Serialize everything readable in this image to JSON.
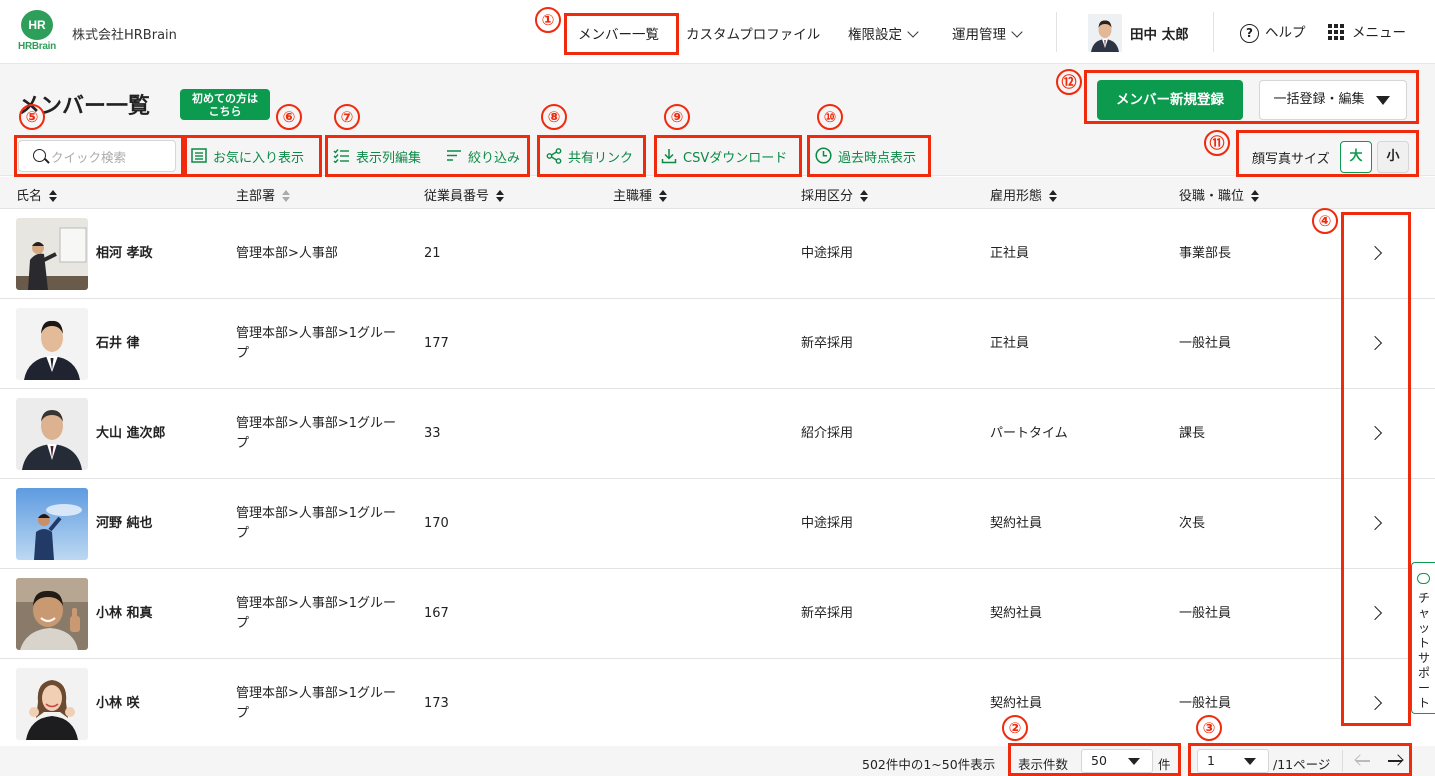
{
  "header": {
    "company": "株式会社HRBrain",
    "logo_mark": "HR",
    "logo_text": "HRBrain",
    "nav": [
      {
        "label": "メンバー一覧"
      },
      {
        "label": "カスタムプロファイル"
      },
      {
        "label": "権限設定"
      },
      {
        "label": "運用管理"
      }
    ],
    "user_name": "田中 太郎",
    "help_label": "ヘルプ",
    "menu_label": "メニュー"
  },
  "page": {
    "title": "メンバー一覧",
    "first_time_badge_line1": "初めての方は",
    "first_time_badge_line2": "こちら",
    "register_button": "メンバー新規登録",
    "bulk_button": "一括登録・編集"
  },
  "toolbar": {
    "search_placeholder": "クイック検索",
    "favorites": "お気に入り表示",
    "edit_columns": "表示列編集",
    "filter": "絞り込み",
    "share_link": "共有リンク",
    "csv_download": "CSVダウンロード",
    "past_view": "過去時点表示",
    "photo_size_label": "顔写真サイズ",
    "size_big": "大",
    "size_small": "小"
  },
  "table": {
    "columns": [
      "氏名",
      "主部署",
      "従業員番号",
      "主職種",
      "採用区分",
      "雇用形態",
      "役職・職位"
    ],
    "rows": [
      {
        "name": "相河 孝政",
        "dept": "管理本部>人事部",
        "emp_no": "21",
        "job": "",
        "hire": "中途採用",
        "form": "正社員",
        "role": "事業部長"
      },
      {
        "name": "石井 律",
        "dept": "管理本部>人事部>1グループ",
        "emp_no": "177",
        "job": "",
        "hire": "新卒採用",
        "form": "正社員",
        "role": "一般社員"
      },
      {
        "name": "大山 進次郎",
        "dept": "管理本部>人事部>1グループ",
        "emp_no": "33",
        "job": "",
        "hire": "紹介採用",
        "form": "パートタイム",
        "role": "課長"
      },
      {
        "name": "河野 純也",
        "dept": "管理本部>人事部>1グループ",
        "emp_no": "170",
        "job": "",
        "hire": "中途採用",
        "form": "契約社員",
        "role": "次長"
      },
      {
        "name": "小林 和真",
        "dept": "管理本部>人事部>1グループ",
        "emp_no": "167",
        "job": "",
        "hire": "新卒採用",
        "form": "契約社員",
        "role": "一般社員"
      },
      {
        "name": "小林 咲",
        "dept": "管理本部>人事部>1グループ",
        "emp_no": "173",
        "job": "",
        "hire": "",
        "form": "契約社員",
        "role": "一般社員"
      }
    ]
  },
  "footer": {
    "total_text": "502件中の1~50件表示",
    "per_page_label": "表示件数",
    "per_page_value": "50",
    "per_page_unit": "件",
    "page_value": "1",
    "page_total": "/11ページ"
  },
  "chat_support": "チャットサポート",
  "annotations": [
    "①",
    "②",
    "③",
    "④",
    "⑤",
    "⑥",
    "⑦",
    "⑧",
    "⑨",
    "⑩",
    "⑪",
    "⑫"
  ],
  "colors": {
    "brand_green": "#0b9a4e",
    "annotation_red": "#ef2a0d"
  }
}
